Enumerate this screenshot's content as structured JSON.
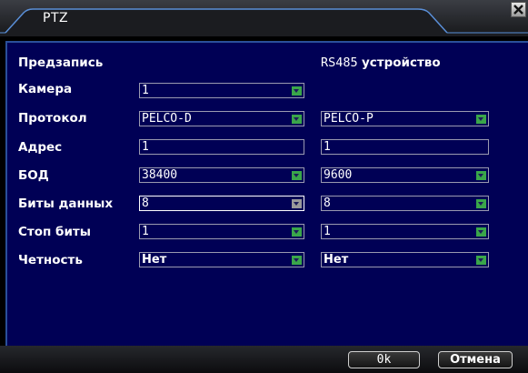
{
  "window": {
    "title": "PTZ"
  },
  "section": {
    "left_header": "Предзапись",
    "right_header_code": "RS485",
    "right_header_word": "устройство"
  },
  "rows": [
    {
      "label": "Камера",
      "value": "1",
      "type": "select"
    },
    {
      "label": "Протокол",
      "value": "PELCO-D",
      "right_value": "PELCO-P",
      "type": "select"
    },
    {
      "label": "Адрес",
      "value": "1",
      "right_value": "1",
      "type": "text"
    },
    {
      "label": "БОД",
      "value": "38400",
      "right_value": "9600",
      "type": "select"
    },
    {
      "label": "Биты данных",
      "value": "8",
      "right_value": "8",
      "type": "select"
    },
    {
      "label": "Стоп биты",
      "value": "1",
      "right_value": "1",
      "type": "select"
    },
    {
      "label": "Четность",
      "value": "Нет",
      "right_value": "Нет",
      "type": "select"
    }
  ],
  "buttons": {
    "ok": "0k",
    "cancel": "Отмена"
  },
  "colors": {
    "panel_bg": "#000055",
    "dropdown_arrow": "#3aa64a",
    "window_bg": "#000000"
  },
  "icons": {
    "close": "close-x-icon",
    "dropdown": "chevron-down-icon"
  }
}
